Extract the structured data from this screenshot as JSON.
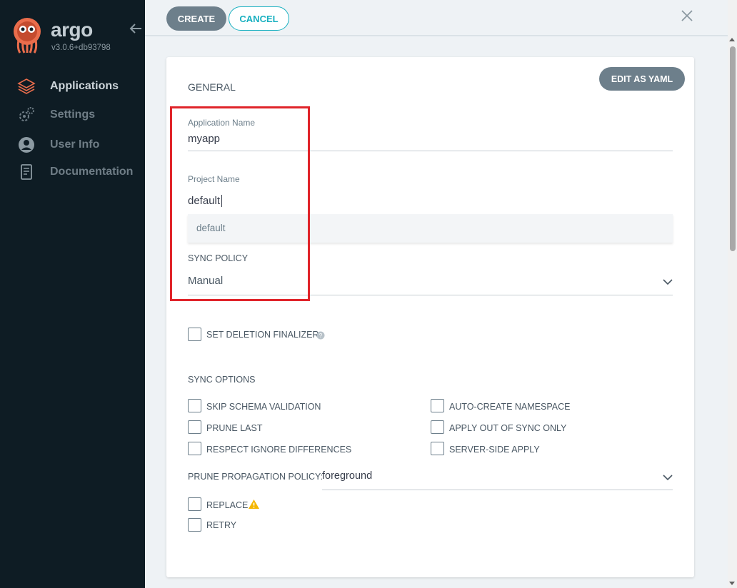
{
  "sidebar": {
    "logo_text": "argo",
    "version": "v3.0.6+db93798",
    "items": [
      {
        "label": "Applications",
        "icon": "layers-icon",
        "active": true
      },
      {
        "label": "Settings",
        "icon": "gears-icon",
        "active": false
      },
      {
        "label": "User Info",
        "icon": "user-circle-icon",
        "active": false
      },
      {
        "label": "Documentation",
        "icon": "book-icon",
        "active": false
      }
    ]
  },
  "toolbar": {
    "create_label": "CREATE",
    "cancel_label": "CANCEL",
    "close_icon": "close-icon"
  },
  "form": {
    "edit_yaml_label": "EDIT AS YAML",
    "general_title": "GENERAL",
    "app_name": {
      "label": "Application Name",
      "value": "myapp"
    },
    "project_name": {
      "label": "Project Name",
      "value": "default"
    },
    "project_suggestions": [
      "default"
    ],
    "sync_policy": {
      "label": "SYNC POLICY",
      "value": "Manual"
    },
    "deletion_finalizer": {
      "label": "SET DELETION FINALIZER",
      "checked": false
    },
    "sync_options_title": "SYNC OPTIONS",
    "sync_options": {
      "left": [
        {
          "label": "SKIP SCHEMA VALIDATION",
          "checked": false
        },
        {
          "label": "PRUNE LAST",
          "checked": false
        },
        {
          "label": "RESPECT IGNORE DIFFERENCES",
          "checked": false
        }
      ],
      "right": [
        {
          "label": "AUTO-CREATE NAMESPACE",
          "checked": false
        },
        {
          "label": "APPLY OUT OF SYNC ONLY",
          "checked": false
        },
        {
          "label": "SERVER-SIDE APPLY",
          "checked": false
        }
      ]
    },
    "prune_propagation": {
      "label": "PRUNE PROPAGATION POLICY:",
      "value": "foreground"
    },
    "replace": {
      "label": "REPLACE",
      "checked": false
    },
    "retry": {
      "label": "RETRY",
      "checked": false
    }
  },
  "colors": {
    "sidebar_bg": "#0e1c24",
    "accent": "#18b0c0",
    "button_gray": "#6d7f8b",
    "highlight_red": "#e0242a",
    "warning": "#f5b700"
  }
}
